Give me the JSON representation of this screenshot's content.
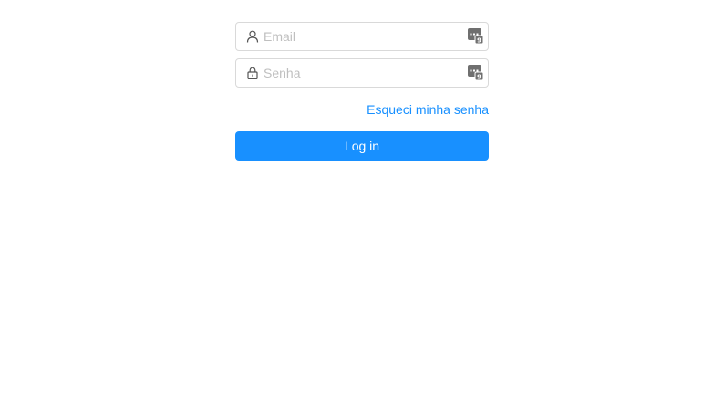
{
  "form": {
    "email": {
      "placeholder": "Email",
      "value": "",
      "icon": "user-icon"
    },
    "password": {
      "placeholder": "Senha",
      "value": "",
      "icon": "lock-icon"
    },
    "password_manager_icon": "password-manager-icon",
    "forgot_label": "Esqueci minha senha",
    "login_label": "Log in"
  },
  "colors": {
    "accent": "#1890ff",
    "border": "#d9d9d9",
    "placeholder": "#bfbfbf",
    "icon": "#555555"
  }
}
